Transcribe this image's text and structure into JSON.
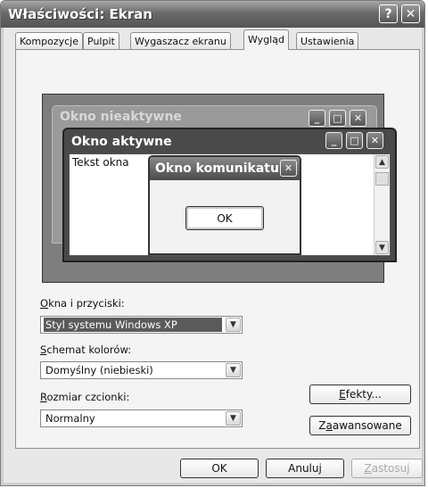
{
  "window": {
    "title": "Właściwości: Ekran",
    "help_glyph": "?",
    "close_glyph": "✕"
  },
  "tabs": [
    {
      "label": "Kompozycje"
    },
    {
      "label": "Pulpit"
    },
    {
      "label": "Wygaszacz ekranu"
    },
    {
      "label": "Wygląd",
      "active": true
    },
    {
      "label": "Ustawienia"
    }
  ],
  "preview": {
    "inactive_title": "Okno nieaktywne",
    "active_title": "Okno aktywne",
    "window_text": "Tekst okna",
    "message_title": "Okno komunikatu",
    "message_ok": "OK",
    "min_glyph": "_",
    "max_glyph": "□",
    "close_glyph": "✕",
    "scroll_up": "▲",
    "scroll_down": "▼"
  },
  "form": {
    "windows_buttons_label_u": "O",
    "windows_buttons_label_rest": "kna i przyciski:",
    "windows_buttons_value": "Styl systemu Windows XP",
    "color_scheme_label_u": "S",
    "color_scheme_label_rest": "chemat kolorów:",
    "color_scheme_value": "Domyślny (niebieski)",
    "font_size_label_u": "R",
    "font_size_label_rest": "ozmiar czcionki:",
    "font_size_value": "Normalny",
    "dropdown_glyph": "▼",
    "effects_u": "E",
    "effects_rest": "fekty...",
    "advanced_pre": "Z",
    "advanced_u": "a",
    "advanced_rest": "awansowane"
  },
  "footer": {
    "ok": "OK",
    "cancel": "Anuluj",
    "apply_u": "Z",
    "apply_rest": "astosuj"
  }
}
